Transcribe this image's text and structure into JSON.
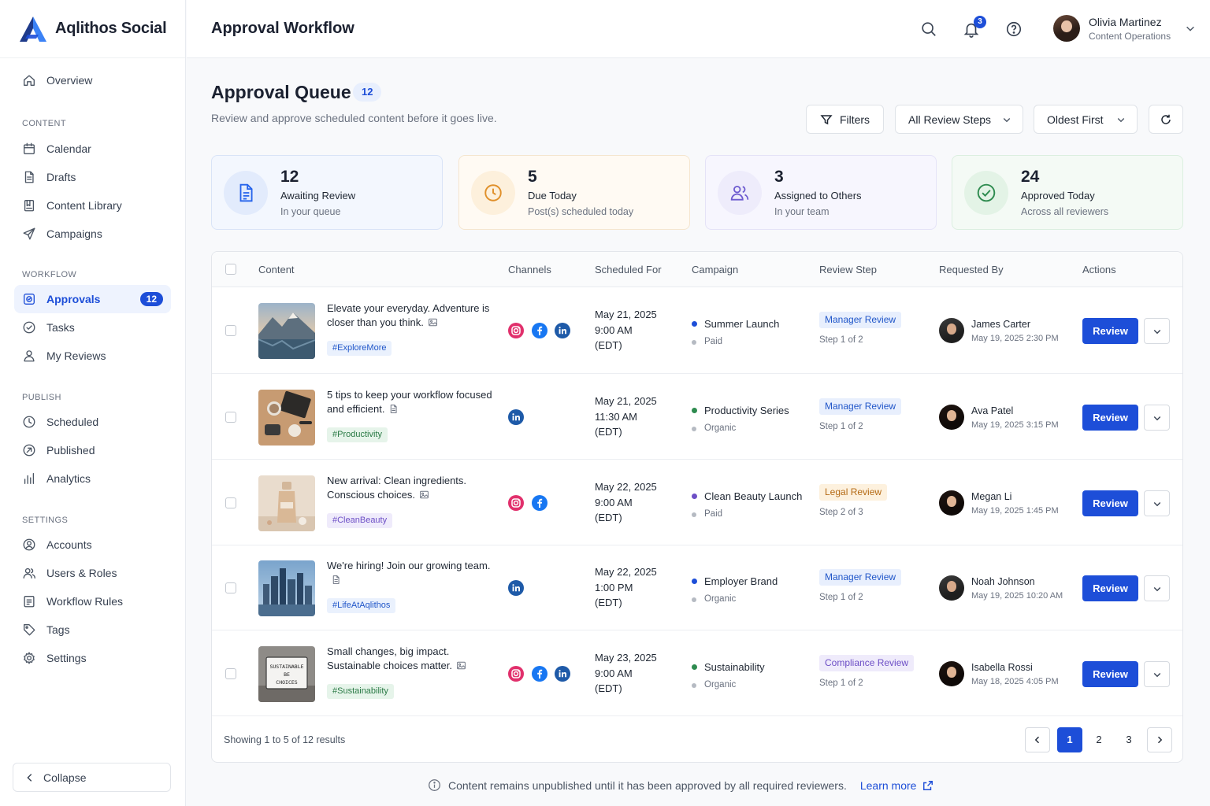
{
  "brand": {
    "name": "Aqlithos Social",
    "colors": {
      "accent": "#1d4ed8",
      "logo_dark": "#1e3a8a",
      "logo_light": "#3b82f6"
    }
  },
  "sidebar": {
    "top_item": {
      "label": "Overview",
      "icon": "home-icon"
    },
    "sections": [
      {
        "title": "CONTENT",
        "items": [
          {
            "label": "Calendar",
            "icon": "calendar-icon"
          },
          {
            "label": "Drafts",
            "icon": "document-icon"
          },
          {
            "label": "Content Library",
            "icon": "library-icon"
          },
          {
            "label": "Campaigns",
            "icon": "send-icon"
          }
        ]
      },
      {
        "title": "WORKFLOW",
        "items": [
          {
            "label": "Approvals",
            "icon": "approval-icon",
            "badge": "12",
            "active": true
          },
          {
            "label": "Tasks",
            "icon": "check-circle-icon"
          },
          {
            "label": "My Reviews",
            "icon": "user-icon"
          }
        ]
      },
      {
        "title": "PUBLISH",
        "items": [
          {
            "label": "Scheduled",
            "icon": "clock-icon"
          },
          {
            "label": "Published",
            "icon": "published-icon"
          },
          {
            "label": "Analytics",
            "icon": "bar-chart-icon"
          }
        ]
      },
      {
        "title": "SETTINGS",
        "items": [
          {
            "label": "Accounts",
            "icon": "account-icon"
          },
          {
            "label": "Users & Roles",
            "icon": "users-icon"
          },
          {
            "label": "Workflow Rules",
            "icon": "rules-icon"
          },
          {
            "label": "Tags",
            "icon": "tag-icon"
          },
          {
            "label": "Settings",
            "icon": "gear-icon"
          }
        ]
      }
    ],
    "collapse_label": "Collapse"
  },
  "header": {
    "title": "Approval Workflow",
    "notification_count": "3",
    "user": {
      "name": "Olivia Martinez",
      "role": "Content Operations"
    }
  },
  "main": {
    "title": "Approval Queue",
    "count_badge": "12",
    "subtitle": "Review and approve scheduled content before it goes live.",
    "controls": {
      "filters": "Filters",
      "review_steps": "All Review Steps",
      "sort": "Oldest First"
    }
  },
  "stats": [
    {
      "value": "12",
      "label": "Awaiting Review",
      "sub": "In your queue",
      "icon": "document-icon"
    },
    {
      "value": "5",
      "label": "Due Today",
      "sub": "Post(s) scheduled today",
      "icon": "clock-icon"
    },
    {
      "value": "3",
      "label": "Assigned to Others",
      "sub": "In your team",
      "icon": "users-icon"
    },
    {
      "value": "24",
      "label": "Approved Today",
      "sub": "Across all reviewers",
      "icon": "check-circle-icon"
    }
  ],
  "table": {
    "columns": [
      "Content",
      "Channels",
      "Scheduled For",
      "Campaign",
      "Review Step",
      "Requested By",
      "Actions"
    ],
    "review_label": "Review",
    "rows": [
      {
        "text": "Elevate your everyday. Adventure is closer than you think.",
        "type_icon": "image-icon",
        "tag": "#ExploreMore",
        "tag_color": "blue",
        "channels": [
          "instagram",
          "facebook",
          "linkedin"
        ],
        "date": "May 21, 2025",
        "time": "9:00 AM",
        "tz": "(EDT)",
        "campaign": "Summer Launch",
        "campaign_color": "#1d4ed8",
        "campaign_type": "Paid",
        "step": "Manager Review",
        "step_kind": "mgr",
        "step_of": "Step 1 of 2",
        "requester": "James Carter",
        "requested_at": "May 19, 2025 2:30 PM",
        "avatar": "m1"
      },
      {
        "text": "5 tips to keep your workflow focused and efficient.",
        "type_icon": "document-icon",
        "tag": "#Productivity",
        "tag_color": "green",
        "channels": [
          "linkedin"
        ],
        "date": "May 21, 2025",
        "time": "11:30 AM",
        "tz": "(EDT)",
        "campaign": "Productivity Series",
        "campaign_color": "#2e8b4f",
        "campaign_type": "Organic",
        "step": "Manager Review",
        "step_kind": "mgr",
        "step_of": "Step 1 of 2",
        "requester": "Ava Patel",
        "requested_at": "May 19, 2025 3:15 PM",
        "avatar": "w1"
      },
      {
        "text": "New arrival: Clean ingredients. Conscious choices.",
        "type_icon": "image-icon",
        "tag": "#CleanBeauty",
        "tag_color": "purple",
        "channels": [
          "instagram",
          "facebook"
        ],
        "date": "May 22, 2025",
        "time": "9:00 AM",
        "tz": "(EDT)",
        "campaign": "Clean Beauty Launch",
        "campaign_color": "#6d4fc6",
        "campaign_type": "Paid",
        "step": "Legal Review",
        "step_kind": "legal",
        "step_of": "Step 2 of 3",
        "requester": "Megan Li",
        "requested_at": "May 19, 2025 1:45 PM",
        "avatar": "w1"
      },
      {
        "text": "We're hiring! Join our growing team.",
        "type_icon": "document-icon",
        "tag": "#LifeAtAqlithos",
        "tag_color": "blue",
        "channels": [
          "linkedin"
        ],
        "date": "May 22, 2025",
        "time": "1:00 PM",
        "tz": "(EDT)",
        "campaign": "Employer Brand",
        "campaign_color": "#1d4ed8",
        "campaign_type": "Organic",
        "step": "Manager Review",
        "step_kind": "mgr",
        "step_of": "Step 1 of 2",
        "requester": "Noah Johnson",
        "requested_at": "May 19, 2025 10:20 AM",
        "avatar": "m1"
      },
      {
        "text": "Small changes, big impact. Sustainable choices matter.",
        "type_icon": "image-icon",
        "tag": "#Sustainability",
        "tag_color": "green",
        "channels": [
          "instagram",
          "facebook",
          "linkedin"
        ],
        "date": "May 23, 2025",
        "time": "9:00 AM",
        "tz": "(EDT)",
        "campaign": "Sustainability",
        "campaign_color": "#2e8b4f",
        "campaign_type": "Organic",
        "step": "Compliance Review",
        "step_kind": "comp",
        "step_of": "Step 1 of 2",
        "requester": "Isabella Rossi",
        "requested_at": "May 18, 2025 4:05 PM",
        "avatar": "w1"
      }
    ],
    "footer": "Showing 1 to 5 of 12 results",
    "pages": [
      "1",
      "2",
      "3"
    ],
    "current_page": "1",
    "thumb_board_text": "SUSTAINABLE\nBE\nCHOICES"
  },
  "footnote": {
    "text": "Content remains unpublished until it has been approved by all required reviewers.",
    "link": "Learn more"
  }
}
